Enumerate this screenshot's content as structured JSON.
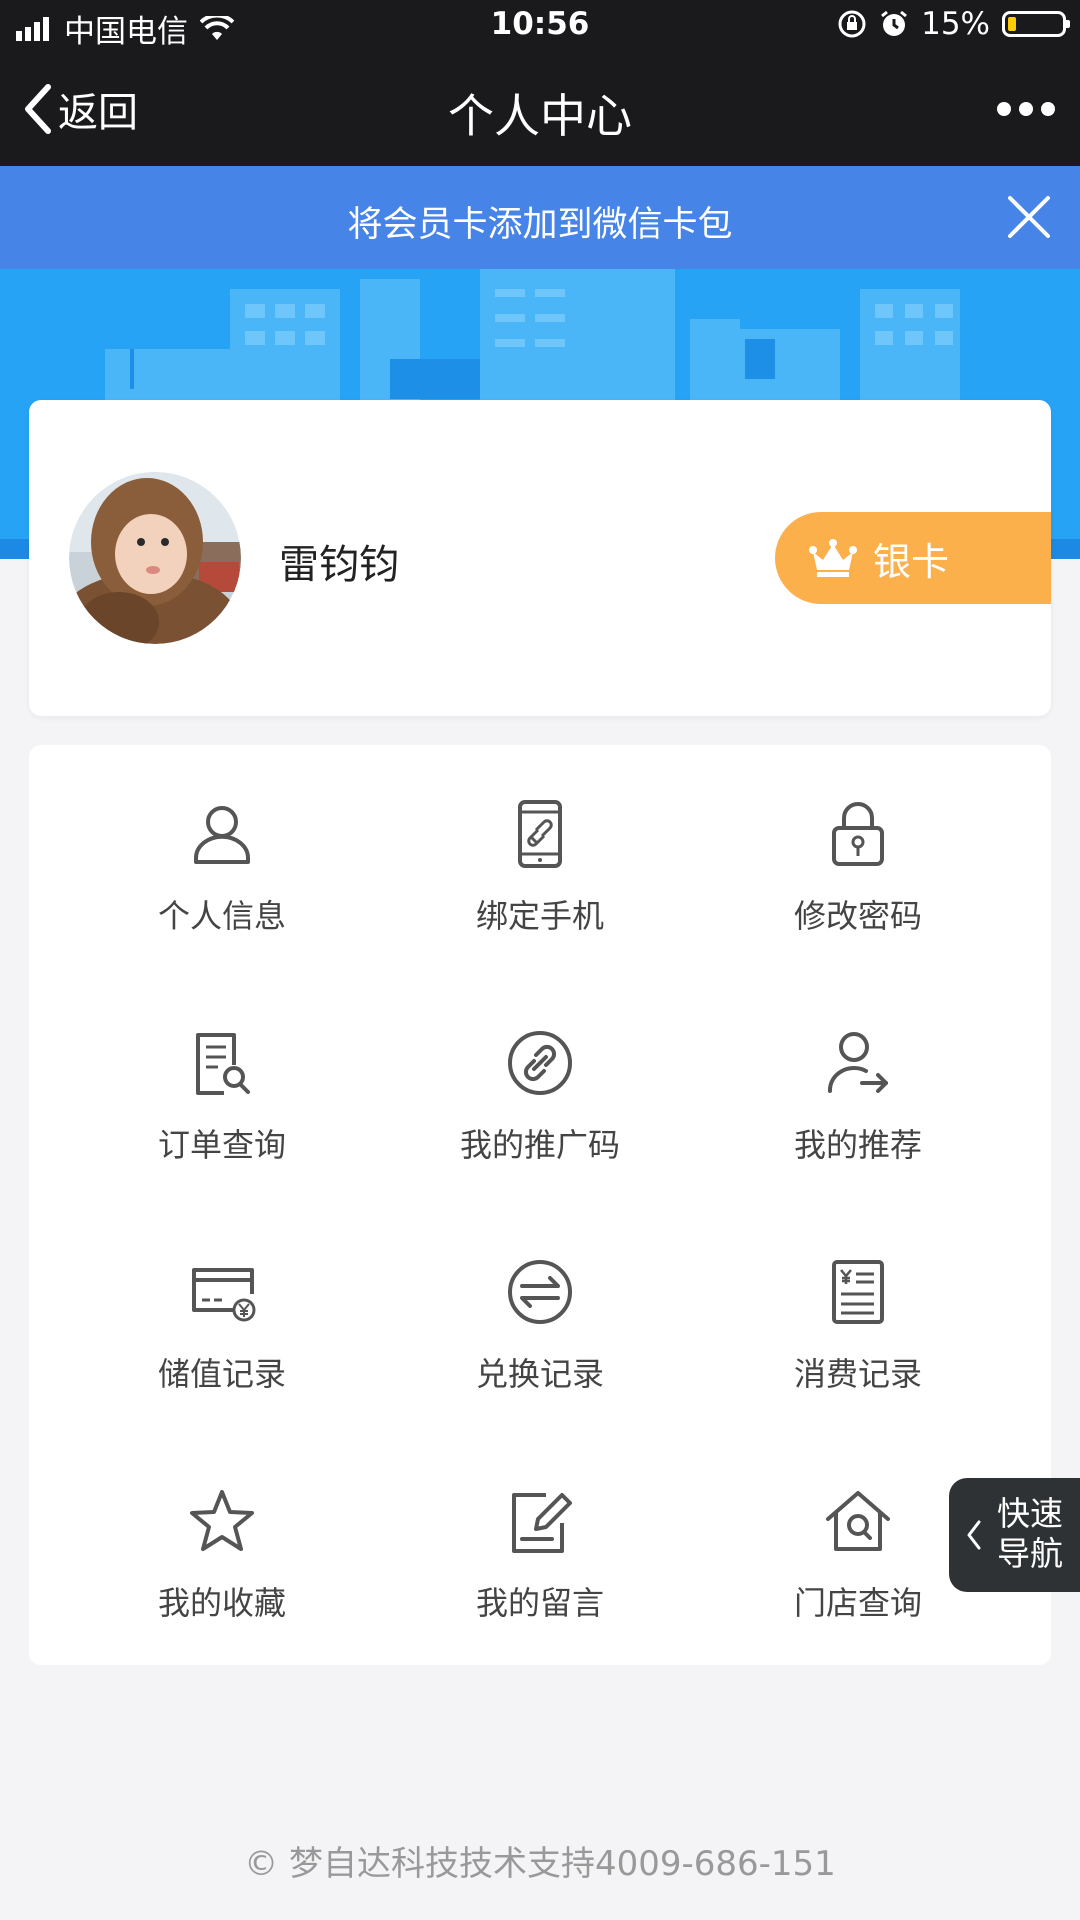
{
  "status_bar": {
    "carrier": "中国电信",
    "time": "10:56",
    "battery": "15%",
    "battery_level": 0.15
  },
  "nav": {
    "back_label": "返回",
    "title": "个人中心"
  },
  "banner": {
    "text": "将会员卡添加到微信卡包"
  },
  "profile": {
    "name": "雷钧钧",
    "level": "银卡"
  },
  "menu": [
    {
      "label": "个人信息",
      "icon": "user-icon"
    },
    {
      "label": "绑定手机",
      "icon": "phone-link-icon"
    },
    {
      "label": "修改密码",
      "icon": "lock-icon"
    },
    {
      "label": "订单查询",
      "icon": "order-search-icon"
    },
    {
      "label": "我的推广码",
      "icon": "link-circle-icon"
    },
    {
      "label": "我的推荐",
      "icon": "user-share-icon"
    },
    {
      "label": "储值记录",
      "icon": "card-yen-icon"
    },
    {
      "label": "兑换记录",
      "icon": "exchange-icon"
    },
    {
      "label": "消费记录",
      "icon": "receipt-icon"
    },
    {
      "label": "我的收藏",
      "icon": "star-icon"
    },
    {
      "label": "我的留言",
      "icon": "edit-note-icon"
    },
    {
      "label": "门店查询",
      "icon": "store-search-icon"
    }
  ],
  "quick_nav": {
    "line1": "快速",
    "line2": "导航"
  },
  "footer": "© 梦自达科技技术支持4009-686-151",
  "colors": {
    "dark": "#1a1a1c",
    "banner": "#4784e8",
    "sky": "#2aa5f6",
    "badge": "#fbb04c"
  }
}
